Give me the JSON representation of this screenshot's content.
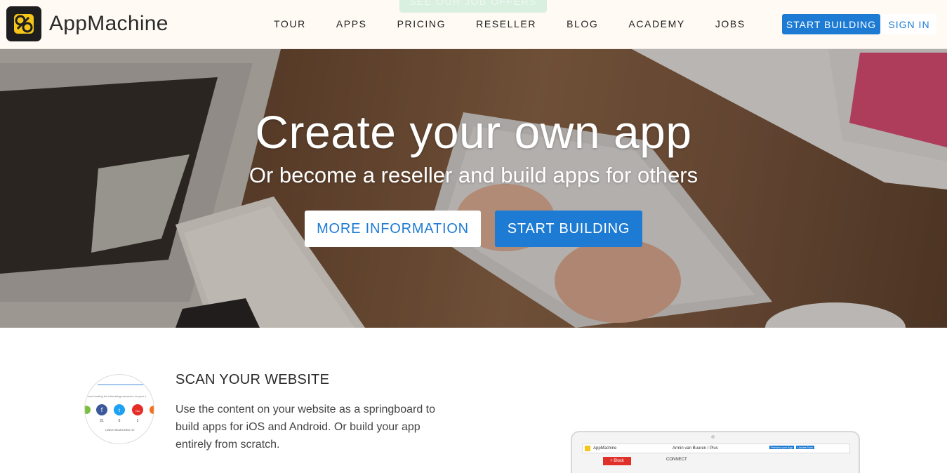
{
  "header": {
    "ghost_button_label": "SEE OUR JOB OFFERS",
    "logo_text": "AppMachine",
    "nav": [
      "TOUR",
      "APPS",
      "PRICING",
      "RESELLER",
      "BLOG",
      "ACADEMY",
      "JOBS"
    ],
    "start_building_label": "START BUILDING",
    "sign_in_label": "SIGN IN"
  },
  "hero": {
    "title": "Create your own app",
    "subtitle": "Or become a reseller and build apps for others",
    "more_info_label": "MORE INFORMATION",
    "start_building_label": "START BUILDING"
  },
  "feature": {
    "title": "SCAN YOUR WEBSITE",
    "description": "Use the content on your website as a springboard to build apps for iOS and Android. Or build your app entirely from scratch.",
    "thumb": {
      "caption": "now hunting for interesting resources on your s",
      "counts": [
        "21",
        "6",
        "2"
      ],
      "links_label": "LINKS SEARCHED: 67"
    },
    "preview": {
      "app_name": "AppMachine",
      "user": "Armin van Buuren / Plus",
      "preview_btn": "Preview your App",
      "update_btn": "Update Now",
      "block_btn": "+ Block",
      "connect_label": "CONNECT"
    }
  },
  "colors": {
    "accent": "#1d7bd4",
    "logo_yellow": "#f5c518",
    "header_bg": "#fffaf4"
  }
}
